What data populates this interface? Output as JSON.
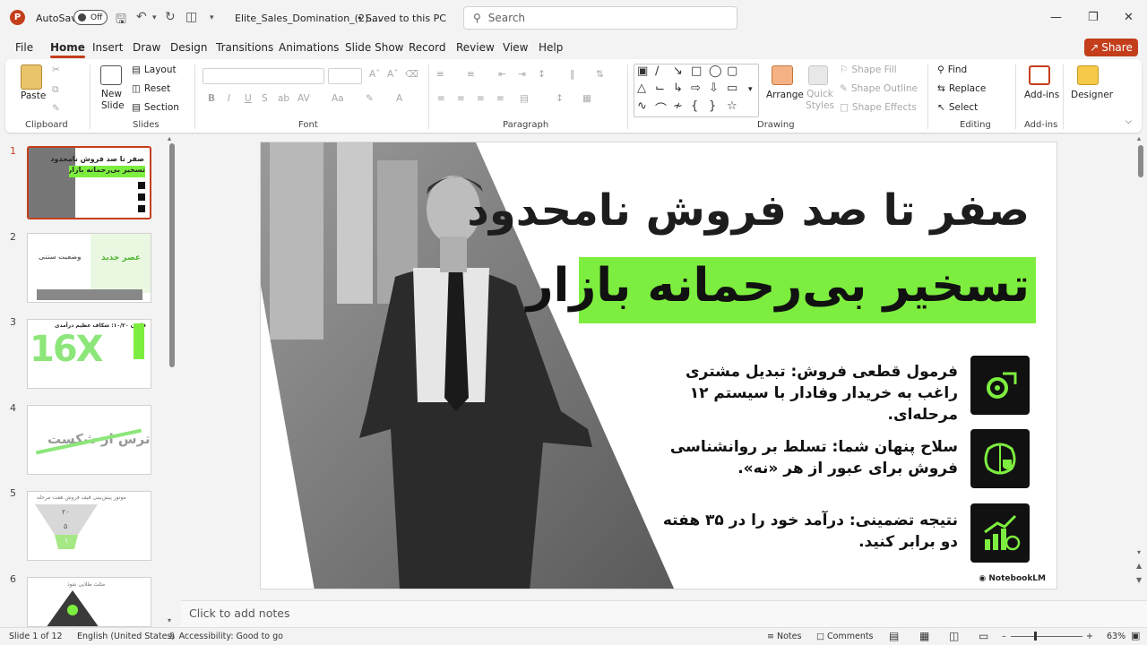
{
  "app": {
    "autosave_label": "AutoSave",
    "autosave_state": "Off",
    "filename": "Elite_Sales_Domination_(2)....",
    "saved_status": "• Saved to this PC",
    "search_placeholder": "Search"
  },
  "menu": [
    "File",
    "Home",
    "Insert",
    "Draw",
    "Design",
    "Transitions",
    "Animations",
    "Slide Show",
    "Record",
    "Review",
    "View",
    "Help"
  ],
  "share_label": "Share",
  "ribbon": {
    "clipboard": {
      "paste": "Paste",
      "label": "Clipboard"
    },
    "slides": {
      "new_slide": "New Slide",
      "layout": "Layout",
      "reset": "Reset",
      "section": "Section",
      "label": "Slides"
    },
    "font": {
      "label": "Font"
    },
    "paragraph": {
      "label": "Paragraph"
    },
    "drawing": {
      "arrange": "Arrange",
      "quick_styles": "Quick Styles",
      "shape_fill": "Shape Fill",
      "shape_outline": "Shape Outline",
      "shape_effects": "Shape Effects",
      "label": "Drawing"
    },
    "editing": {
      "find": "Find",
      "replace": "Replace",
      "select": "Select",
      "label": "Editing"
    },
    "addins": {
      "addins": "Add-ins",
      "label": "Add-ins"
    },
    "designer": "Designer"
  },
  "slides_panel": [
    {
      "num": "1",
      "title": "صفر تا صد فروش نامحدود",
      "sub": "تسخیر بی‌رحمانه بازار"
    },
    {
      "num": "2",
      "title": "عصر جدید",
      "sub": "وضعیت سنتی"
    },
    {
      "num": "3",
      "title": "قانون ۱۰/۲۰: شکاف عظیم درآمدی",
      "big": "16X"
    },
    {
      "num": "4",
      "title": "ترس از شکست"
    },
    {
      "num": "5",
      "title": "موتور پیش‌بینی قیف فروش هفت مرحله",
      "n1": "۲۰",
      "n2": "۵",
      "n3": "۱"
    },
    {
      "num": "6",
      "title": "مثلث طلایی نفوذ"
    }
  ],
  "slide": {
    "title_line1": "صفر تا صد فروش نامحدود",
    "title_line2": "تسخیر بی‌رحمانه بازار",
    "bullets": [
      {
        "text": "فرمول قطعی فروش: تبدیل مشتری راغب به خریدار وفادار با سیستم ۱۲ مرحله‌ای.",
        "icon": "gear-growth-icon"
      },
      {
        "text": "سلاح پنهان شما: تسلط بر روانشناسی فروش برای عبور از هر «نه».",
        "icon": "brain-shield-icon"
      },
      {
        "text": "نتیجه تضمینی: درآمد خود را در ۳۵ هفته دو برابر کنید.",
        "icon": "chart-money-icon"
      }
    ],
    "watermark": "NotebookLM"
  },
  "notes_placeholder": "Click to add notes",
  "status": {
    "slide_info": "Slide 1 of 12",
    "language": "English (United States)",
    "accessibility": "Accessibility: Good to go",
    "notes": "Notes",
    "comments": "Comments",
    "zoom": "63%"
  },
  "colors": {
    "accent": "#c43e1c",
    "highlight": "#7dee3f"
  }
}
